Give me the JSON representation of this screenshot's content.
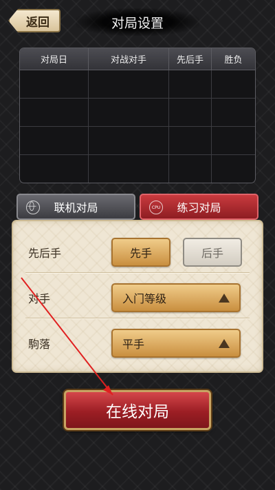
{
  "header": {
    "back_label": "返回",
    "title": "对局设置"
  },
  "records": {
    "columns": [
      "对局日",
      "对战对手",
      "先后手",
      "胜负"
    ],
    "rows": [
      [
        "",
        "",
        "",
        ""
      ],
      [
        "",
        "",
        "",
        ""
      ],
      [
        "",
        "",
        "",
        ""
      ],
      [
        "",
        "",
        "",
        ""
      ]
    ]
  },
  "mode_tabs": {
    "online_label": "联机对局",
    "practice_label": "练习对局",
    "practice_icon_text": "CPU",
    "selected": "练习对局"
  },
  "settings": {
    "turn_order": {
      "label": "先后手",
      "first_label": "先手",
      "second_label": "后手",
      "selected": "先手"
    },
    "opponent": {
      "label": "对手",
      "value": "入门等级"
    },
    "handicap": {
      "label": "駒落",
      "value": "平手"
    }
  },
  "start_button_label": "在线对局",
  "colors": {
    "background": "#1d1d1f",
    "accent_red": "#9c1e24",
    "accent_gold": "#c98f3f",
    "panel_cream": "#efe6d4",
    "annotation_arrow": "#e02020"
  },
  "icons": {
    "online_tab": "globe-icon",
    "practice_tab": "cpu-icon",
    "dropdown": "triangle-up-icon"
  }
}
